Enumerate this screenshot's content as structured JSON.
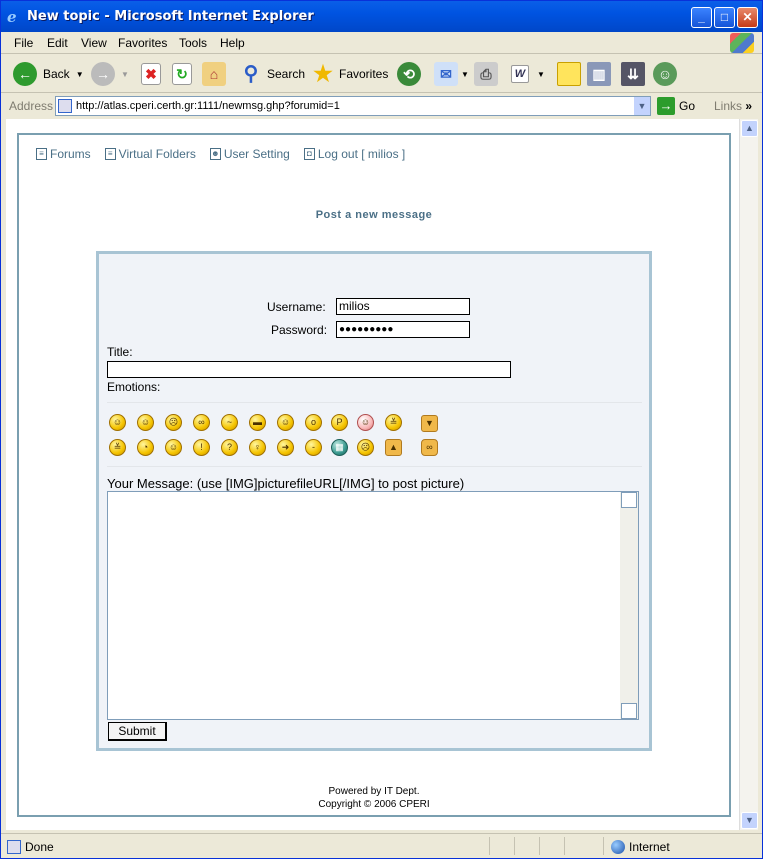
{
  "window": {
    "title": "New topic - Microsoft Internet Explorer",
    "buttons": {
      "minimize": "_",
      "maximize": "□",
      "close": "✕"
    }
  },
  "menu": [
    "File",
    "Edit",
    "View",
    "Favorites",
    "Tools",
    "Help"
  ],
  "toolbar": {
    "back": "Back",
    "search": "Search",
    "favorites": "Favorites"
  },
  "address": {
    "label": "Address",
    "url": "http://atlas.cperi.certh.gr:1111/newmsg.ghp?forumid=1",
    "go": "Go",
    "links": "Links"
  },
  "nav": {
    "forums": "Forums",
    "virtual_folders": "Virtual Folders",
    "user_setting": "User Setting",
    "logout": "Log out [ milios ]"
  },
  "heading": "Post a new message",
  "form": {
    "username_label": "Username:",
    "username_value": "milios",
    "password_label": "Password:",
    "password_value": "●●●●●●●●●",
    "title_label": "Title:",
    "title_value": "",
    "emotions_label": "Emotions:",
    "message_label": "Your Message: (use [IMG]picturefileURL[/IMG] to post picture)",
    "message_value": "",
    "submit": "Submit"
  },
  "emotions_row1": [
    "big-grin",
    "smile-teeth",
    "sad",
    "eyeglasses",
    "confused",
    "cool",
    "laugh",
    "surprised",
    "tongue",
    "blush",
    "devil",
    "thumbs-down"
  ],
  "emotions_row2": [
    "evil-grin",
    "rolling-eyes",
    "wink",
    "exclamation",
    "question",
    "idea",
    "arrow",
    "neutral",
    "teeth",
    "unhappy",
    "thumbs-up",
    "handshake"
  ],
  "footer": {
    "line1": "Powered by IT Dept.",
    "line2": "Copyright © 2006 CPERI"
  },
  "status": {
    "done": "Done",
    "zone": "Internet"
  }
}
